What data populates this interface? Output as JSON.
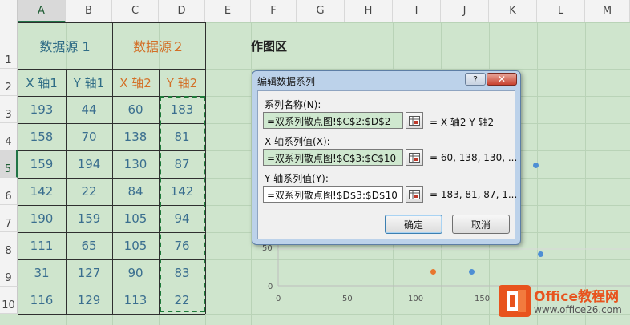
{
  "columns": [
    "A",
    "B",
    "C",
    "D",
    "E",
    "F",
    "G",
    "H",
    "I",
    "J",
    "K",
    "L",
    "M"
  ],
  "rows": [
    "1",
    "2",
    "3",
    "4",
    "5",
    "6",
    "7",
    "8",
    "9",
    "10"
  ],
  "headers": {
    "src1": "数据源 1",
    "src2": "数据源２",
    "x1": "X 轴1",
    "y1": "Y 轴1",
    "x2": "X 轴2",
    "y2": "Y 轴2"
  },
  "table": [
    [
      "193",
      "44",
      "60",
      "183"
    ],
    [
      "158",
      "70",
      "138",
      "81"
    ],
    [
      "159",
      "194",
      "130",
      "87"
    ],
    [
      "142",
      "22",
      "84",
      "142"
    ],
    [
      "190",
      "159",
      "105",
      "94"
    ],
    [
      "111",
      "65",
      "105",
      "76"
    ],
    [
      "31",
      "127",
      "90",
      "83"
    ],
    [
      "116",
      "129",
      "113",
      "22"
    ]
  ],
  "plot_area_title": "作图区",
  "dialog": {
    "title": "编辑数据系列",
    "help_label": "?",
    "close_label": "✕",
    "series_name_label": "系列名称(N):",
    "series_name_value": "=双系列散点图!$C$2:$D$2",
    "series_name_preview": "=  X 轴2  Y 轴2",
    "x_values_label": "X 轴系列值(X):",
    "x_values_value": "=双系列散点图!$C$3:$C$10",
    "x_values_preview": "= 60, 138, 130, ...",
    "y_values_label": "Y 轴系列值(Y):",
    "y_values_value": "=双系列散点图!$D$3:$D$10",
    "y_values_preview": "= 183, 81, 87, 1...",
    "ok_label": "确定",
    "cancel_label": "取消"
  },
  "chart_axis": {
    "x_ticks": [
      "0",
      "50",
      "100",
      "150"
    ],
    "y_ticks": [
      "50",
      "0"
    ]
  },
  "watermark": {
    "brand": "Office教程网",
    "url": "www.office26.com"
  },
  "colors": {
    "series1": "#4e8fd4",
    "series2": "#e8772e",
    "accent": "#217346"
  }
}
